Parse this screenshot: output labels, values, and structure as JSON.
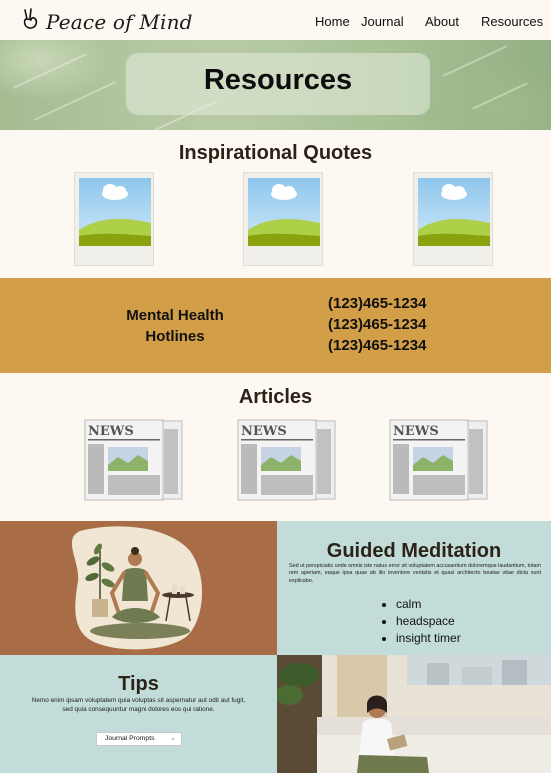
{
  "nav": {
    "logo_text": "Peace of Mind",
    "links": [
      "Home",
      "Journal",
      "About",
      "Resources"
    ]
  },
  "banner": {
    "title": "Resources"
  },
  "quotes": {
    "title": "Inspirational Quotes"
  },
  "hotlines": {
    "label_line1": "Mental Health",
    "label_line2": "Hotlines",
    "numbers": [
      "(123)465-1234",
      "(123)465-1234",
      "(123)465-1234"
    ]
  },
  "articles": {
    "title": "Articles",
    "news_label": "NEWS"
  },
  "meditation": {
    "title": "Guided Meditation",
    "text": "Sed ut perspiciatis unde omnis iste natus error sit voluptatem accusantium doloremque laudantium, totam rem aperiam, eaque ipsa quae ab illo inventore veritatis et quasi architecto beatae vitae dicta sunt explicabo.",
    "items": [
      "calm",
      "headspace",
      "insight timer"
    ]
  },
  "tips": {
    "title": "Tips",
    "text": "Nemo enim ipsam voluptatem quia voluptas sit aspernatur aut odit aut fugit, sed quia consequuntur magni dolores eos qui ratione.",
    "select_value": "Journal Prompts"
  }
}
